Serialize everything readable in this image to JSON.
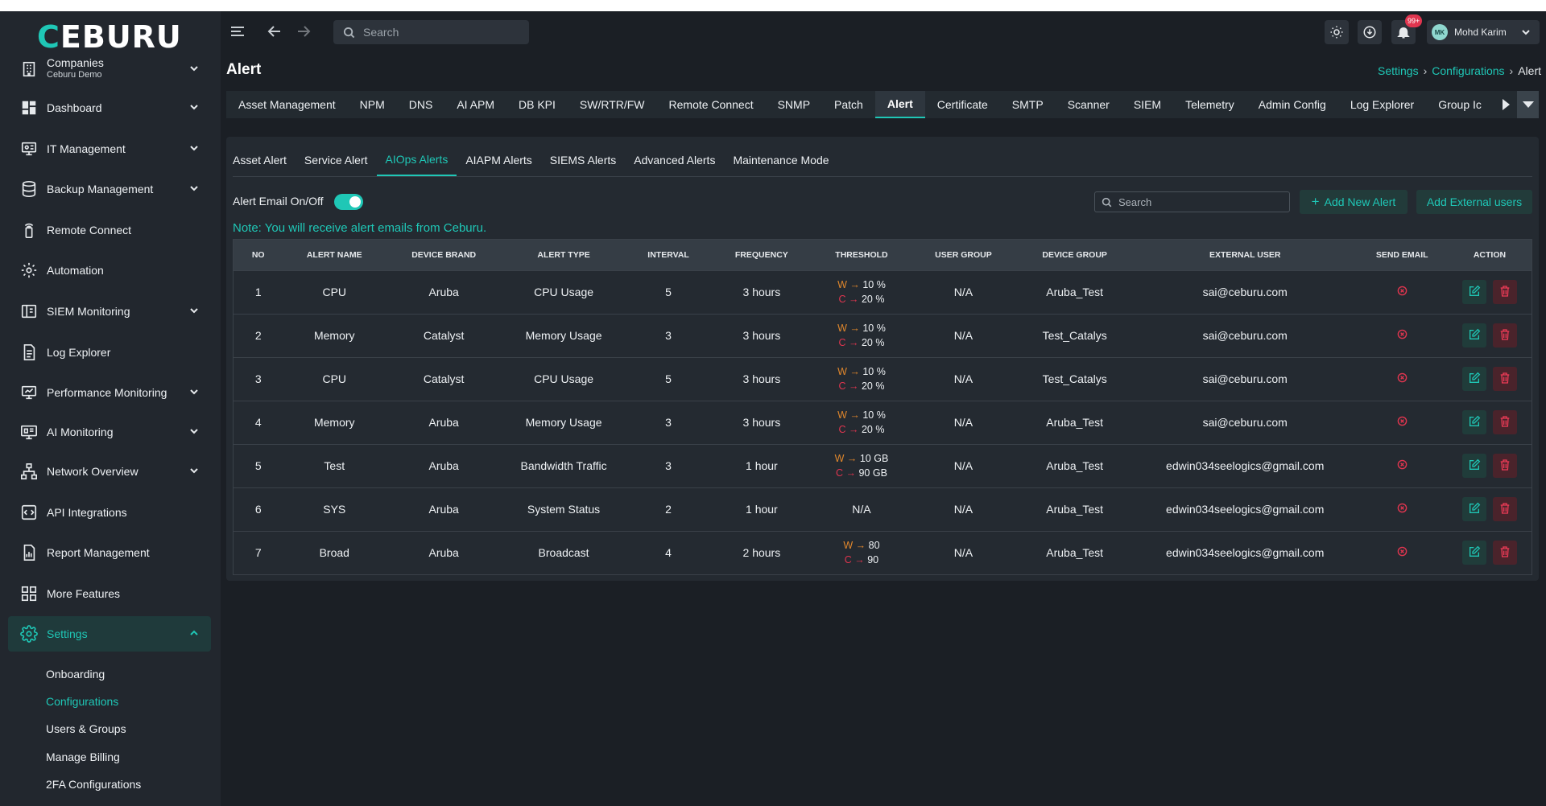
{
  "app": {
    "logo": "CEBURU",
    "logo_first": "C",
    "logo_rest": "EBURU"
  },
  "header": {
    "search_placeholder": "Search",
    "notifications_badge": "99+",
    "user_initials": "MK",
    "user_name": "Mohd Karim"
  },
  "sidebar": {
    "items": [
      {
        "label": "Companies",
        "sub": "Ceburu Demo",
        "icon": "building-icon"
      },
      {
        "label": "Dashboard",
        "icon": "dashboard-icon"
      },
      {
        "label": "IT Management",
        "icon": "it-management-icon"
      },
      {
        "label": "Backup Management",
        "icon": "database-icon"
      },
      {
        "label": "Remote Connect",
        "icon": "remote-icon"
      },
      {
        "label": "Automation",
        "icon": "gear-icon"
      },
      {
        "label": "SIEM Monitoring",
        "icon": "siem-icon"
      },
      {
        "label": "Log Explorer",
        "icon": "document-icon"
      },
      {
        "label": "Performance Monitoring",
        "icon": "monitor-icon"
      },
      {
        "label": "AI Monitoring",
        "icon": "ai-monitor-icon"
      },
      {
        "label": "Network Overview",
        "icon": "network-icon"
      },
      {
        "label": "API Integrations",
        "icon": "api-icon"
      },
      {
        "label": "Report Management",
        "icon": "report-icon"
      },
      {
        "label": "More Features",
        "icon": "grid-icon"
      },
      {
        "label": "Settings",
        "icon": "settings-icon"
      }
    ],
    "settings_sub": [
      "Onboarding",
      "Configurations",
      "Users & Groups",
      "Manage Billing",
      "2FA Configurations"
    ]
  },
  "page": {
    "title": "Alert",
    "breadcrumb": [
      "Settings",
      "Configurations",
      "Alert"
    ]
  },
  "top_tabs": [
    "Asset Management",
    "NPM",
    "DNS",
    "AI APM",
    "DB KPI",
    "SW/RTR/FW",
    "Remote Connect",
    "SNMP",
    "Patch",
    "Alert",
    "Certificate",
    "SMTP",
    "Scanner",
    "SIEM",
    "Telemetry",
    "Admin Config",
    "Log Explorer",
    "Group Ic"
  ],
  "sub_tabs": [
    "Asset Alert",
    "Service Alert",
    "AIOps Alerts",
    "AIAPM Alerts",
    "SIEMS Alerts",
    "Advanced Alerts",
    "Maintenance Mode"
  ],
  "controls": {
    "toggle_label": "Alert Email On/Off",
    "toggle_on": true,
    "search_placeholder": "Search",
    "add_new_alert": "Add New Alert",
    "add_external_users": "Add External users",
    "note": "Note: You will receive alert emails from Ceburu."
  },
  "table": {
    "columns": [
      "NO",
      "ALERT NAME",
      "DEVICE BRAND",
      "ALERT TYPE",
      "INTERVAL",
      "FREQUENCY",
      "THRESHOLD",
      "USER GROUP",
      "DEVICE GROUP",
      "EXTERNAL USER",
      "SEND EMAIL",
      "ACTION"
    ],
    "rows": [
      {
        "no": "1",
        "name": "CPU",
        "brand": "Aruba",
        "type": "CPU Usage",
        "interval": "5",
        "frequency": "3 hours",
        "thr_w": "W → ",
        "thr_w_val": "10 %",
        "thr_c": "C → ",
        "thr_c_val": "20 %",
        "user_group": "N/A",
        "device_group": "Aruba_Test",
        "external_user": "sai@ceburu.com"
      },
      {
        "no": "2",
        "name": "Memory",
        "brand": "Catalyst",
        "type": "Memory Usage",
        "interval": "3",
        "frequency": "3 hours",
        "thr_w": "W → ",
        "thr_w_val": "10 %",
        "thr_c": "C → ",
        "thr_c_val": "20 %",
        "user_group": "N/A",
        "device_group": "Test_Catalys",
        "external_user": "sai@ceburu.com"
      },
      {
        "no": "3",
        "name": "CPU",
        "brand": "Catalyst",
        "type": "CPU Usage",
        "interval": "5",
        "frequency": "3 hours",
        "thr_w": "W → ",
        "thr_w_val": "10 %",
        "thr_c": "C → ",
        "thr_c_val": "20 %",
        "user_group": "N/A",
        "device_group": "Test_Catalys",
        "external_user": "sai@ceburu.com"
      },
      {
        "no": "4",
        "name": "Memory",
        "brand": "Aruba",
        "type": "Memory Usage",
        "interval": "3",
        "frequency": "3 hours",
        "thr_w": "W → ",
        "thr_w_val": "10 %",
        "thr_c": "C → ",
        "thr_c_val": "20 %",
        "user_group": "N/A",
        "device_group": "Aruba_Test",
        "external_user": "sai@ceburu.com"
      },
      {
        "no": "5",
        "name": "Test",
        "brand": "Aruba",
        "type": "Bandwidth Traffic",
        "interval": "3",
        "frequency": "1 hour",
        "thr_w": "W → ",
        "thr_w_val": "10 GB",
        "thr_c": "C → ",
        "thr_c_val": "90 GB",
        "user_group": "N/A",
        "device_group": "Aruba_Test",
        "external_user": "edwin034seelogics@gmail.com"
      },
      {
        "no": "6",
        "name": "SYS",
        "brand": "Aruba",
        "type": "System Status",
        "interval": "2",
        "frequency": "1 hour",
        "thr_na": "N/A",
        "user_group": "N/A",
        "device_group": "Aruba_Test",
        "external_user": "edwin034seelogics@gmail.com"
      },
      {
        "no": "7",
        "name": "Broad",
        "brand": "Aruba",
        "type": "Broadcast",
        "interval": "4",
        "frequency": "2 hours",
        "thr_w": "W → ",
        "thr_w_val": "80",
        "thr_c": "C → ",
        "thr_c_val": "90",
        "user_group": "N/A",
        "device_group": "Aruba_Test",
        "external_user": "edwin034seelogics@gmail.com"
      }
    ]
  }
}
